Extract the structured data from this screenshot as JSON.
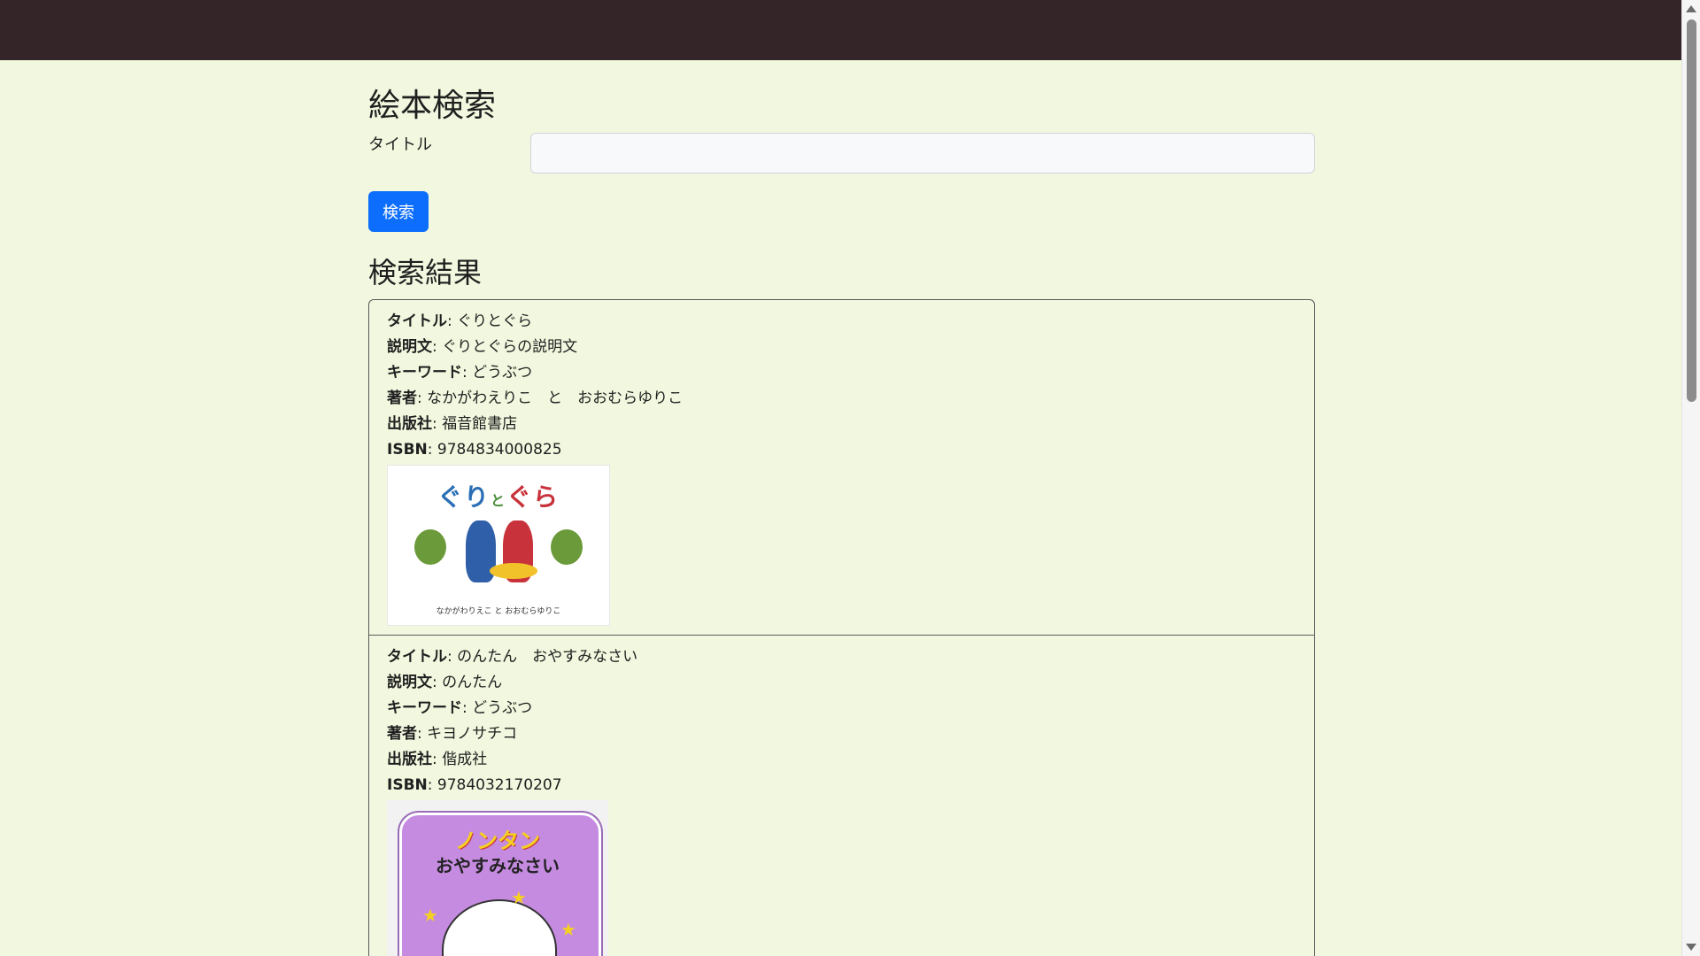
{
  "page": {
    "title": "絵本検索",
    "search_label": "タイトル",
    "search_value": "",
    "search_button": "検索",
    "results_title": "検索結果"
  },
  "labels": {
    "title": "タイトル",
    "description": "説明文",
    "keyword": "キーワード",
    "author": "著者",
    "publisher": "出版社",
    "isbn": "ISBN"
  },
  "results": [
    {
      "title": "ぐりとぐら",
      "description": "ぐりとぐらの説明文",
      "keyword": "どうぶつ",
      "author": "なかがわえりこ　と　おおむらゆりこ",
      "publisher": "福音館書店",
      "isbn": "9784834000825",
      "cover": {
        "icon": "book-cover-image"
      }
    },
    {
      "title": "のんたん　おやすみなさい",
      "description": "のんたん",
      "keyword": "どうぶつ",
      "author": "キヨノサチコ",
      "publisher": "偕成社",
      "isbn": "9784032170207",
      "cover": {
        "icon": "book-cover-image"
      }
    }
  ]
}
